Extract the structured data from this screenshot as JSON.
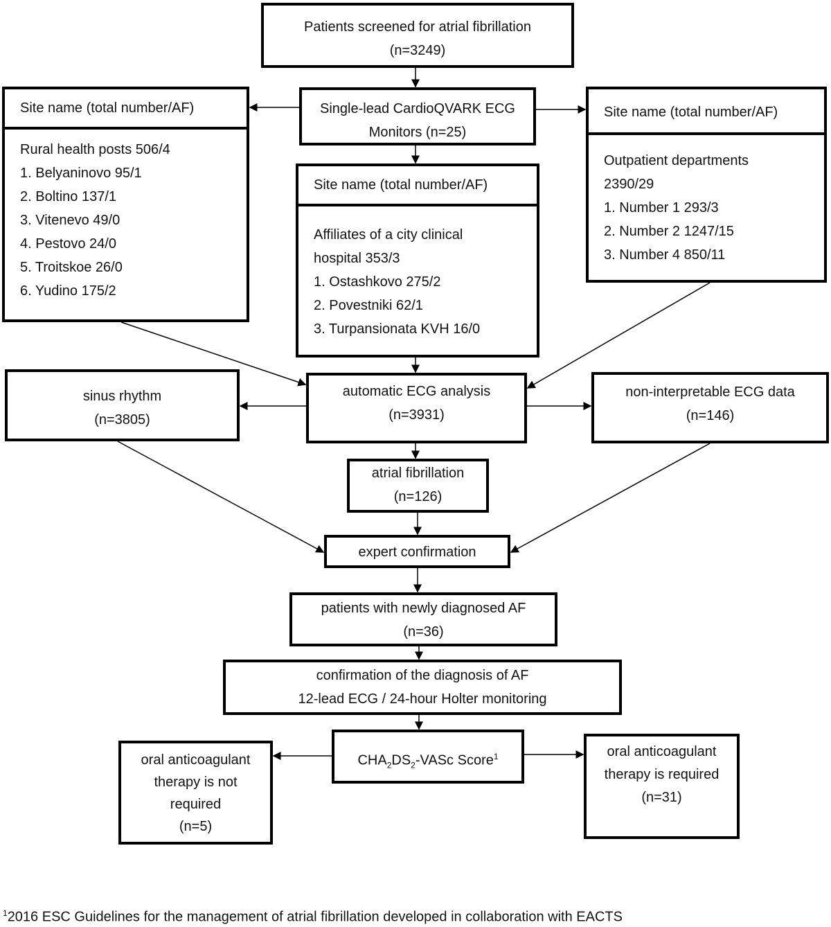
{
  "screened": {
    "line1": "Patients screened for atrial fibrillation",
    "line2": "(n=3249)"
  },
  "monitors": {
    "line1": "Single-lead CardioQVARK ECG",
    "line2": "Monitors (n=25)"
  },
  "site_header": "Site name (total number/AF)",
  "rural": {
    "items": [
      "Rural health posts 506/4",
      "1. Belyaninovo 95/1",
      "2. Boltino 137/1",
      "3. Vitenevo 49/0",
      "4. Pestovo 24/0",
      "5. Troitskoe 26/0",
      "6. Yudino 175/2"
    ]
  },
  "affiliates": {
    "items": [
      "Affiliates of a city clinical",
      "hospital 353/3",
      "1. Ostashkovo 275/2",
      "2. Povestniki  62/1",
      "3. Turpansionata KVH 16/0"
    ]
  },
  "outpatient": {
    "items": [
      "Outpatient departments",
      "2390/29",
      "1. Number 1 293/3",
      "2. Number 2 1247/15",
      "3. Number 4 850/11"
    ]
  },
  "sinus": {
    "line1": "sinus rhythm",
    "line2": "(n=3805)"
  },
  "automatic": {
    "line1": "automatic ECG analysis",
    "line2": "(n=3931)"
  },
  "noninterp": {
    "line1": "non-interpretable ECG data",
    "line2": "(n=146)"
  },
  "af": {
    "line1": "atrial fibrillation",
    "line2": "(n=126)"
  },
  "expert": {
    "line1": "expert confirmation"
  },
  "newly": {
    "line1": "patients with newly diagnosed AF",
    "line2": "(n=36)"
  },
  "confirmation": {
    "line1": "confirmation of the diagnosis of AF",
    "line2": "12-lead ECG / 24-hour Holter monitoring"
  },
  "score": {
    "p1": "CHA",
    "s1": "2",
    "p2": "DS",
    "s2": "2",
    "p3": "-VASc Score",
    "sup": "1"
  },
  "not_required": {
    "line1": "oral anticoagulant",
    "line2": "therapy is not",
    "line3": "required",
    "line4": "(n=5)"
  },
  "required": {
    "line1": "oral anticoagulant",
    "line2": "therapy is required",
    "line3": "(n=31)"
  },
  "footnote": {
    "mark": "1",
    "text": "2016 ESC Guidelines for the management of atrial fibrillation developed in collaboration with EACTS"
  }
}
